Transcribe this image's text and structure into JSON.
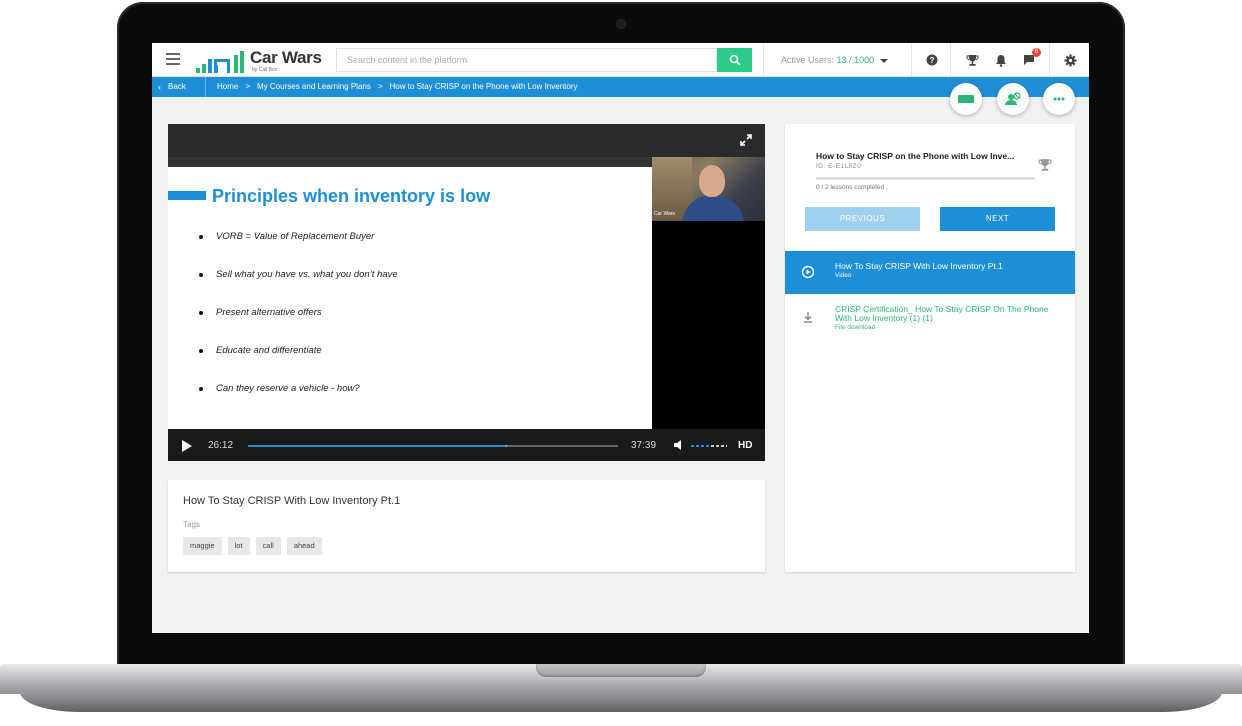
{
  "app": {
    "logo_text": "Car Wars",
    "logo_sub": "by Call Box"
  },
  "search": {
    "placeholder": "Search content in the platform"
  },
  "active_users": {
    "label": "Active Users:",
    "current": "13",
    "separator": " / ",
    "max": "1000"
  },
  "notifications": {
    "badge_count": "6"
  },
  "breadcrumb": {
    "back_label": "Back",
    "items": [
      "Home",
      "My Courses and Learning Plans",
      "How to Stay CRISP on the Phone with Low Inventory"
    ]
  },
  "slide": {
    "title": "Principles when inventory is low",
    "bullets": [
      "VORB = Value of Replacement Buyer",
      "Sell what you have vs. what you don’t have",
      "Present alternative offers",
      "Educate and differentiate",
      "Can they reserve a vehicle - how?"
    ],
    "webcam_label": "Car Wars"
  },
  "player": {
    "current_time": "26:12",
    "duration": "37:39",
    "progress_fraction": 0.696,
    "buffered_fraction": 0.7,
    "volume_fraction": 0.55,
    "quality_label": "HD"
  },
  "info": {
    "title": "How To Stay CRISP With Low Inventory Pt.1",
    "tags_label": "Tags",
    "tags": [
      "maggie",
      "lot",
      "call",
      "ahead"
    ]
  },
  "course": {
    "title": "How to Stay CRISP on the Phone with Low Inve...",
    "id": "ID: E-E1L5Z0",
    "lessons_completed": "0 / 2 lessons completed",
    "progress_fraction": 0,
    "previous_label": "PREVIOUS",
    "next_label": "NEXT",
    "lessons": [
      {
        "title": "How To Stay CRISP With Low Inventory Pt.1",
        "type": "Video",
        "icon": "play-circle-icon"
      },
      {
        "title": "CRISP Certification_ How To Stay CRISP On The Phone With Low Inventory (1) (1)",
        "type": "File download",
        "icon": "download-icon"
      }
    ]
  },
  "colors": {
    "primary": "#1e8fd6",
    "accent_green": "#2bb673",
    "search_button": "#2bcc8a",
    "badge_red": "#e74c3c"
  }
}
